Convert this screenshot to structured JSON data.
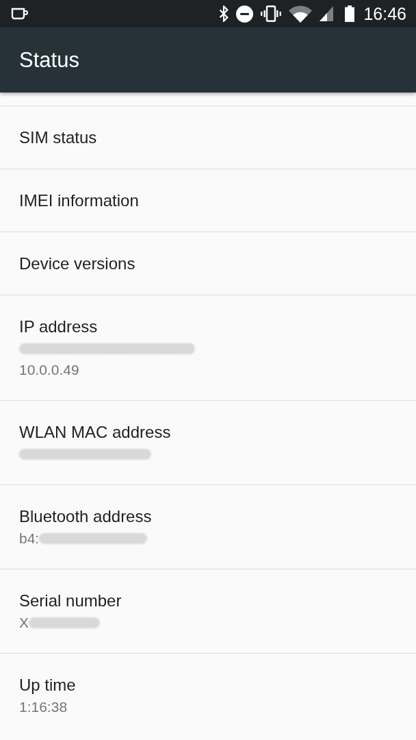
{
  "status_bar": {
    "time": "16:46"
  },
  "app_bar": {
    "title": "Status"
  },
  "items": [
    {
      "title": "SIM status"
    },
    {
      "title": "IMEI information"
    },
    {
      "title": "Device versions"
    },
    {
      "title": "IP address",
      "summary": [
        {
          "redacted": true
        },
        {
          "text": "10.0.0.49",
          "redacted": false
        }
      ]
    },
    {
      "title": "WLAN MAC address",
      "summary": [
        {
          "redacted": true
        }
      ]
    },
    {
      "title": "Bluetooth address",
      "summary": [
        {
          "text": "b4:",
          "redacted": true
        }
      ]
    },
    {
      "title": "Serial number",
      "summary": [
        {
          "text": "X",
          "redacted": true
        }
      ]
    },
    {
      "title": "Up time",
      "summary": [
        {
          "text": "1:16:38",
          "redacted": false
        }
      ]
    }
  ]
}
